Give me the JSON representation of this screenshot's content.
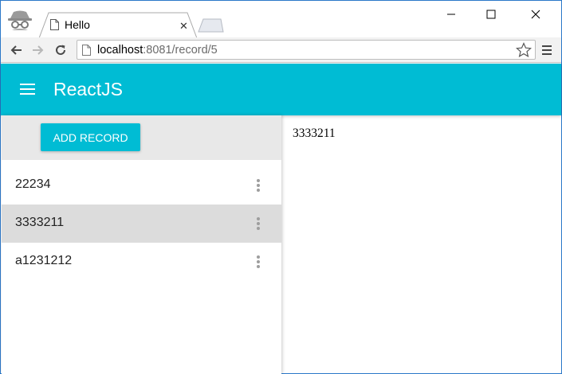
{
  "browser": {
    "tab_title": "Hello",
    "url_host": "localhost",
    "url_path": ":8081/record/5"
  },
  "app": {
    "title": "ReactJS",
    "add_button_label": "ADD RECORD",
    "accent": "#00bcd4"
  },
  "records": [
    {
      "label": "22234",
      "selected": false
    },
    {
      "label": "3333211",
      "selected": true
    },
    {
      "label": "a1231212",
      "selected": false
    }
  ],
  "detail": {
    "value": "3333211"
  },
  "icons": {
    "incognito": "incognito-icon",
    "back": "back-arrow-icon",
    "forward": "forward-arrow-icon",
    "reload": "reload-icon",
    "star": "star-icon",
    "menu": "browser-menu-icon",
    "hamburger": "hamburger-icon",
    "more": "more-vert-icon"
  }
}
